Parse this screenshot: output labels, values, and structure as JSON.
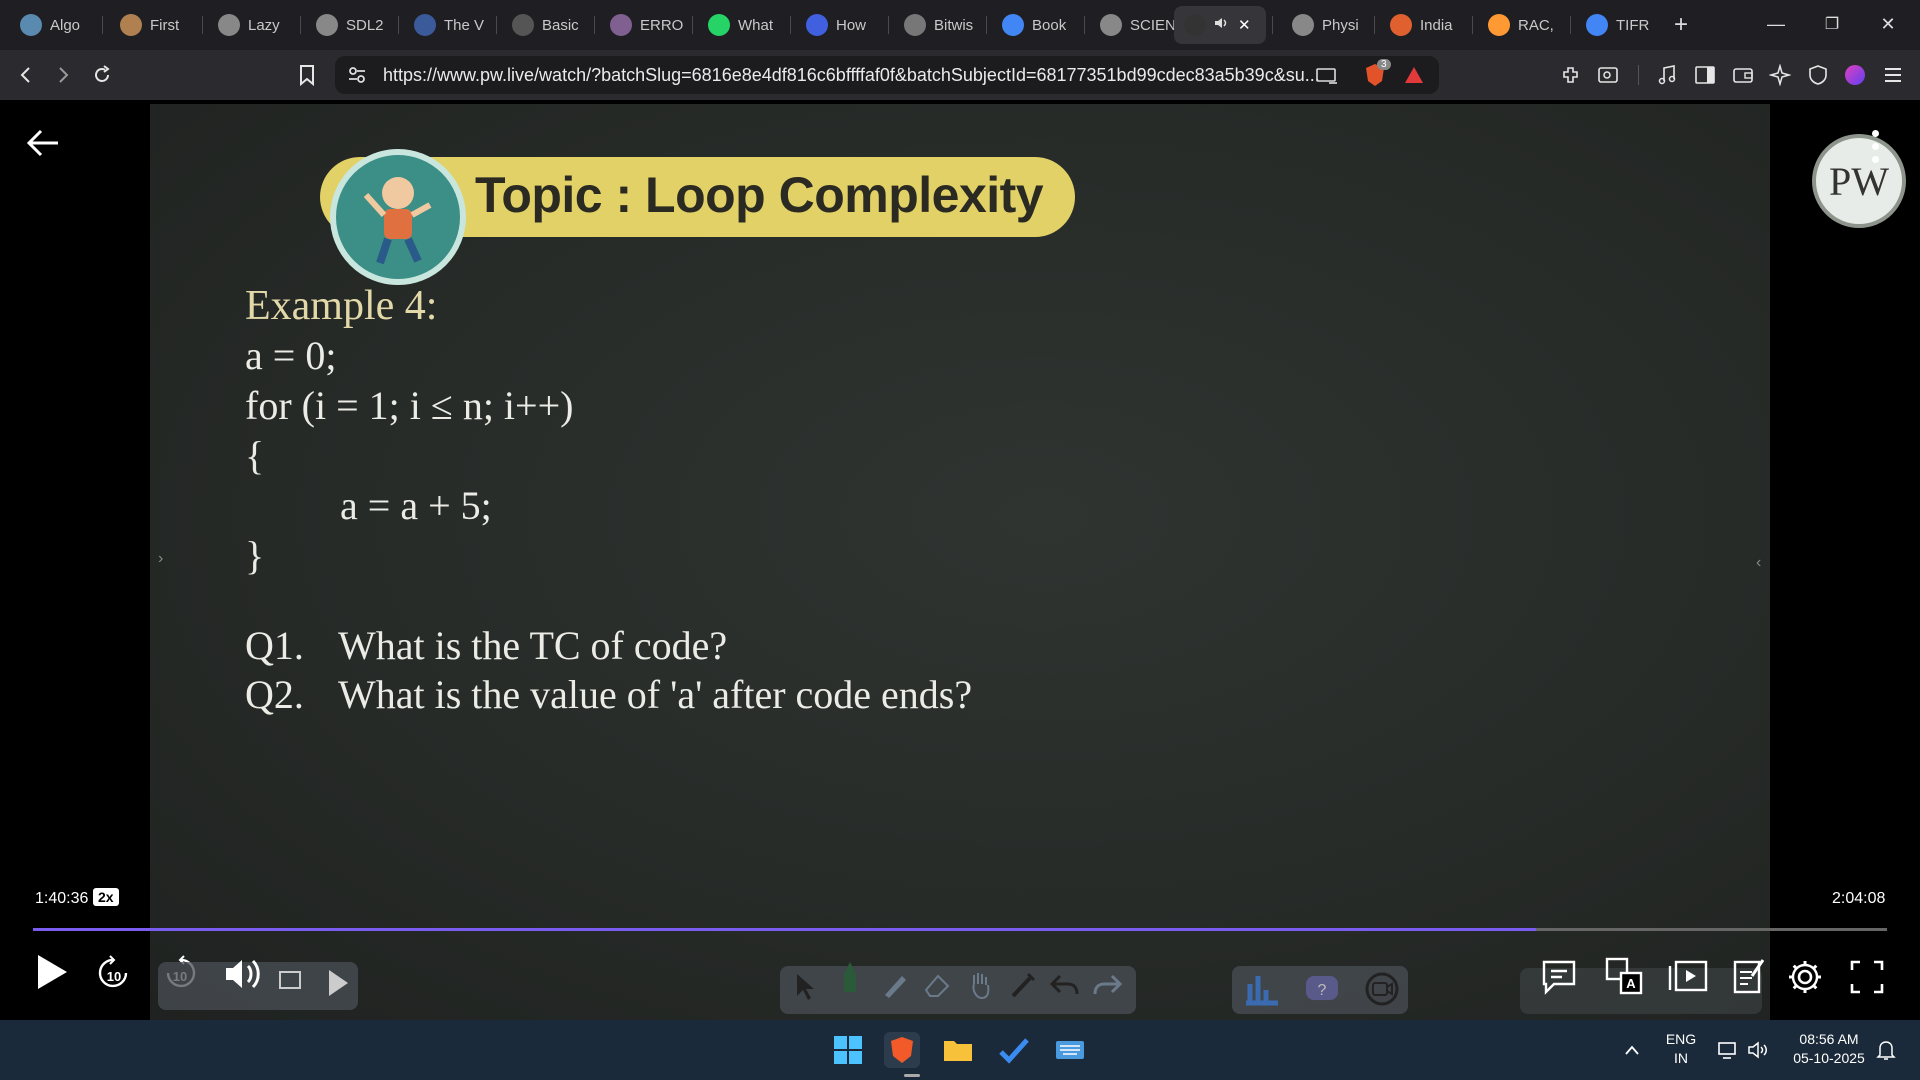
{
  "tabs": [
    {
      "label": "Algo",
      "icon": "algo-icon",
      "color": "#5a8ab0"
    },
    {
      "label": "First",
      "icon": "codechef-icon",
      "color": "#b08050"
    },
    {
      "label": "Lazy",
      "icon": "github-icon",
      "color": "#888888"
    },
    {
      "label": "SDL2",
      "icon": "github-icon",
      "color": "#888888"
    },
    {
      "label": "The V",
      "icon": "w3-icon",
      "color": "#3a5a9a"
    },
    {
      "label": "Basic",
      "icon": "site-icon",
      "color": "#555555"
    },
    {
      "label": "ERRO",
      "icon": "site-icon",
      "color": "#806090"
    },
    {
      "label": "What",
      "icon": "whatsapp-icon",
      "color": "#25d366"
    },
    {
      "label": "How",
      "icon": "bookmark-icon",
      "color": "#4060e0"
    },
    {
      "label": "Bitwis",
      "icon": "site-icon",
      "color": "#777777"
    },
    {
      "label": "Book",
      "icon": "google-icon",
      "color": "#4285f4"
    },
    {
      "label": "SCIEN",
      "icon": "globe-icon",
      "color": "#888888"
    },
    {
      "label": "",
      "icon": "pw-icon",
      "color": "#333333"
    },
    {
      "label": "Physi",
      "icon": "wiki-icon",
      "color": "#888888"
    },
    {
      "label": "India",
      "icon": "site-icon",
      "color": "#e06030"
    },
    {
      "label": "RAC,",
      "icon": "flag-icon",
      "color": "#ff9933"
    },
    {
      "label": "TIFR",
      "icon": "google-icon",
      "color": "#4285f4"
    }
  ],
  "new_tab": "+",
  "window": {
    "minimize": "—",
    "restore": "❐",
    "close": "✕"
  },
  "toolbar": {
    "url": "https://www.pw.live/watch/?batchSlug=6816e8e4df816c6bffffaf0f&batchSubjectId=68177351bd99cdec83a5b39c&su...",
    "shield_count": "3"
  },
  "slide": {
    "topic": "Topic : Loop Complexity",
    "example_title": "Example 4:",
    "code": [
      "a = 0;",
      "for (i = 1; i ≤ n; i++)",
      "{",
      "a = a + 5;",
      "}"
    ],
    "questions": [
      {
        "num": "Q1.",
        "text": "What is the TC of code?"
      },
      {
        "num": "Q2.",
        "text": "What is the value of 'a' after code ends?"
      }
    ],
    "logo": "PW"
  },
  "player": {
    "time_elapsed": "1:40:36",
    "speed": "2x",
    "time_total": "2:04:08",
    "progress_fraction": 0.8108,
    "skip_back": "10",
    "skip_forward": "10",
    "accent": "#7b5cf0"
  },
  "taskbar": {
    "lang_top": "ENG",
    "lang_bottom": "IN",
    "time": "08:56 AM",
    "date": "05-10-2025"
  }
}
